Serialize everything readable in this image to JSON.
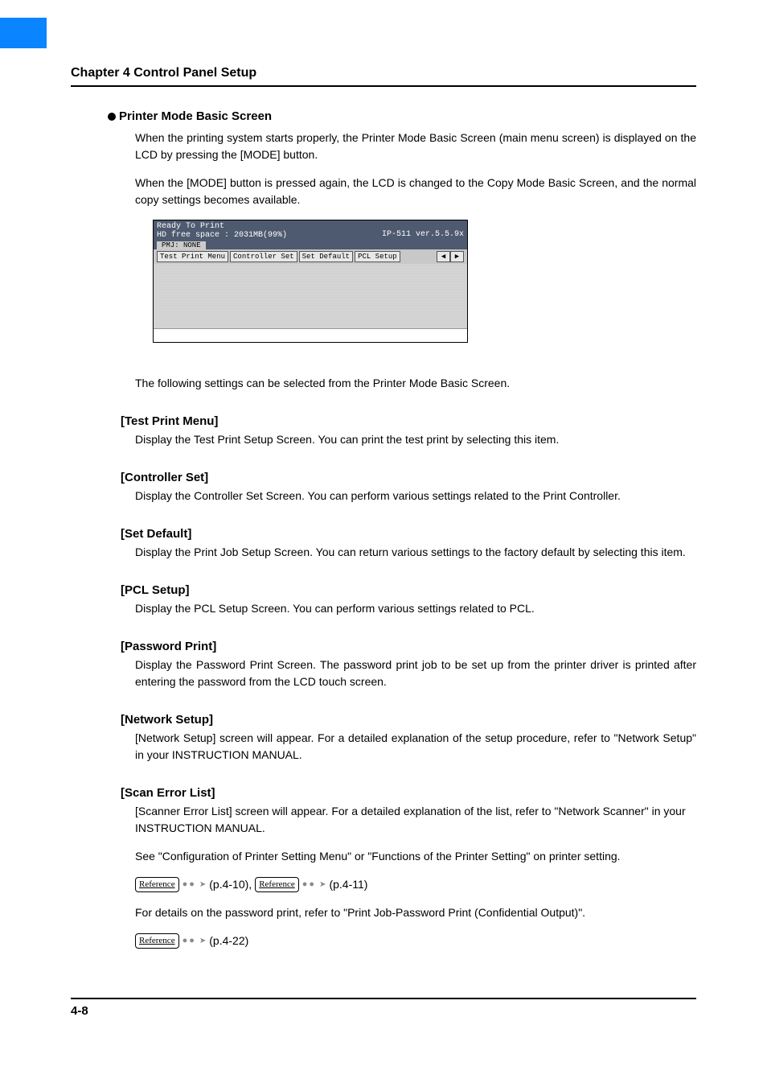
{
  "chapter_title": "Chapter 4 Control Panel Setup",
  "section": {
    "title": "Printer Mode Basic Screen",
    "para1": "When the printing system starts properly, the Printer Mode Basic Screen (main menu screen) is displayed on the LCD by pressing the [MODE] button.",
    "para2": "When the [MODE] button is pressed again, the LCD is changed to the Copy Mode Basic Screen, and the normal copy settings becomes available.",
    "after_screen": "The following settings can be selected from the Printer Mode Basic Screen."
  },
  "screen": {
    "ready": "Ready To Print",
    "hd": "HD free space : 2031MB(99%)",
    "ip_ver": "IP-511 ver.5.5.9x",
    "pmj": "PMJ: NONE",
    "tabs": [
      "Test Print Menu",
      "Controller Set",
      "Set Default",
      "PCL Setup"
    ],
    "arrow_left": "◀",
    "arrow_right": "▶"
  },
  "items": {
    "test_print": {
      "title": "[Test Print Menu]",
      "body": "Display the Test Print Setup Screen. You can print the test print by selecting this item."
    },
    "controller_set": {
      "title": "[Controller Set]",
      "body": "Display the Controller Set Screen. You can perform various settings related to the Print Controller."
    },
    "set_default": {
      "title": "[Set Default]",
      "body": "Display the Print Job Setup  Screen. You can return various settings to the factory default by selecting this item."
    },
    "pcl_setup": {
      "title": "[PCL Setup]",
      "body": "Display the PCL Setup Screen. You can perform various settings related to PCL."
    },
    "password_print": {
      "title": "[Password Print]",
      "body": "Display the Password Print Screen. The password print job to be set up from the printer driver is printed after entering the password from the LCD touch screen."
    },
    "network_setup": {
      "title": "[Network Setup]",
      "body": "[Network Setup] screen will appear. For a detailed explanation of the setup procedure, refer to \"Network Setup\" in your INSTRUCTION MANUAL."
    },
    "scan_error": {
      "title": "[Scan Error List]",
      "body": "[Scanner Error List] screen will appear. For a detailed explanation of the list, refer to \"Network Scanner\" in your INSTRUCTION MANUAL."
    }
  },
  "footer_text": {
    "see_config": "See \"Configuration of Printer Setting Menu\" or \"Functions of the Printer Setting\"  on printer setting.",
    "ref_label": "Reference",
    "ref1_page": "(p.4-10),",
    "ref2_page": "(p.4-11)",
    "details": "For details on the password print, refer to \"Print Job-Password Print (Confidential Output)\".",
    "ref3_page": "(p.4-22)"
  },
  "page_number": "4-8"
}
